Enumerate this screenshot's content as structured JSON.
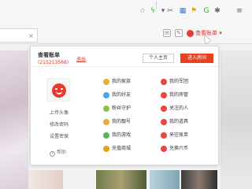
{
  "browser": {
    "toolbar_icons": [
      {
        "name": "star-icon",
        "glyph": "☆",
        "color": "#888888"
      },
      {
        "name": "lightning-icon",
        "glyph": "ϟ",
        "color": "#3aa23a"
      },
      {
        "name": "dropdown-icon",
        "glyph": "▾",
        "color": "#666666"
      },
      {
        "name": "scissors-icon",
        "glyph": "✂",
        "color": "#666666"
      },
      {
        "name": "grid-icon",
        "glyph": "▦",
        "color": "#3d77c9"
      },
      {
        "name": "flag-icon",
        "glyph": "⚑",
        "color": "#e6a21f"
      },
      {
        "name": "g-icon",
        "glyph": "G",
        "color": "#3aa23a"
      },
      {
        "name": "puzzle-icon",
        "glyph": "✱",
        "color": "#666666"
      },
      {
        "name": "menu-icon",
        "glyph": "≡",
        "color": "#555555"
      }
    ],
    "url_close": "×"
  },
  "site_bar": {
    "icons": [
      "mail-icon",
      "edit-icon",
      "gift-icon"
    ],
    "account_link": "查看账单",
    "account_caret": "▾"
  },
  "panel": {
    "title": "查看账单",
    "uid": "(215213568)",
    "logout": "退出",
    "home_button": "个人主页",
    "room_button": "进入房间",
    "left_links": [
      "上传头像",
      "修改密码",
      "设置密保"
    ],
    "help": "帮助",
    "help_glyph": "?",
    "menu": [
      {
        "label": "我的家族",
        "color": "#f0a93b"
      },
      {
        "label": "我的军团",
        "color": "#e6483b"
      },
      {
        "label": "我的好友",
        "color": "#4aa4e8"
      },
      {
        "label": "我的房管",
        "color": "#e6483b"
      },
      {
        "label": "粉丝守护",
        "color": "#8bc34a"
      },
      {
        "label": "关注的人",
        "color": "#e6483b"
      },
      {
        "label": "我的靓号",
        "color": "#f0a93b"
      },
      {
        "label": "我的道具",
        "color": "#e6483b"
      },
      {
        "label": "我的游戏",
        "color": "#5ab55a"
      },
      {
        "label": "来往账单",
        "color": "#e6483b"
      },
      {
        "label": "充值商城",
        "color": "#e6a21f"
      },
      {
        "label": "兑换六币",
        "color": "#e6483b"
      }
    ]
  }
}
